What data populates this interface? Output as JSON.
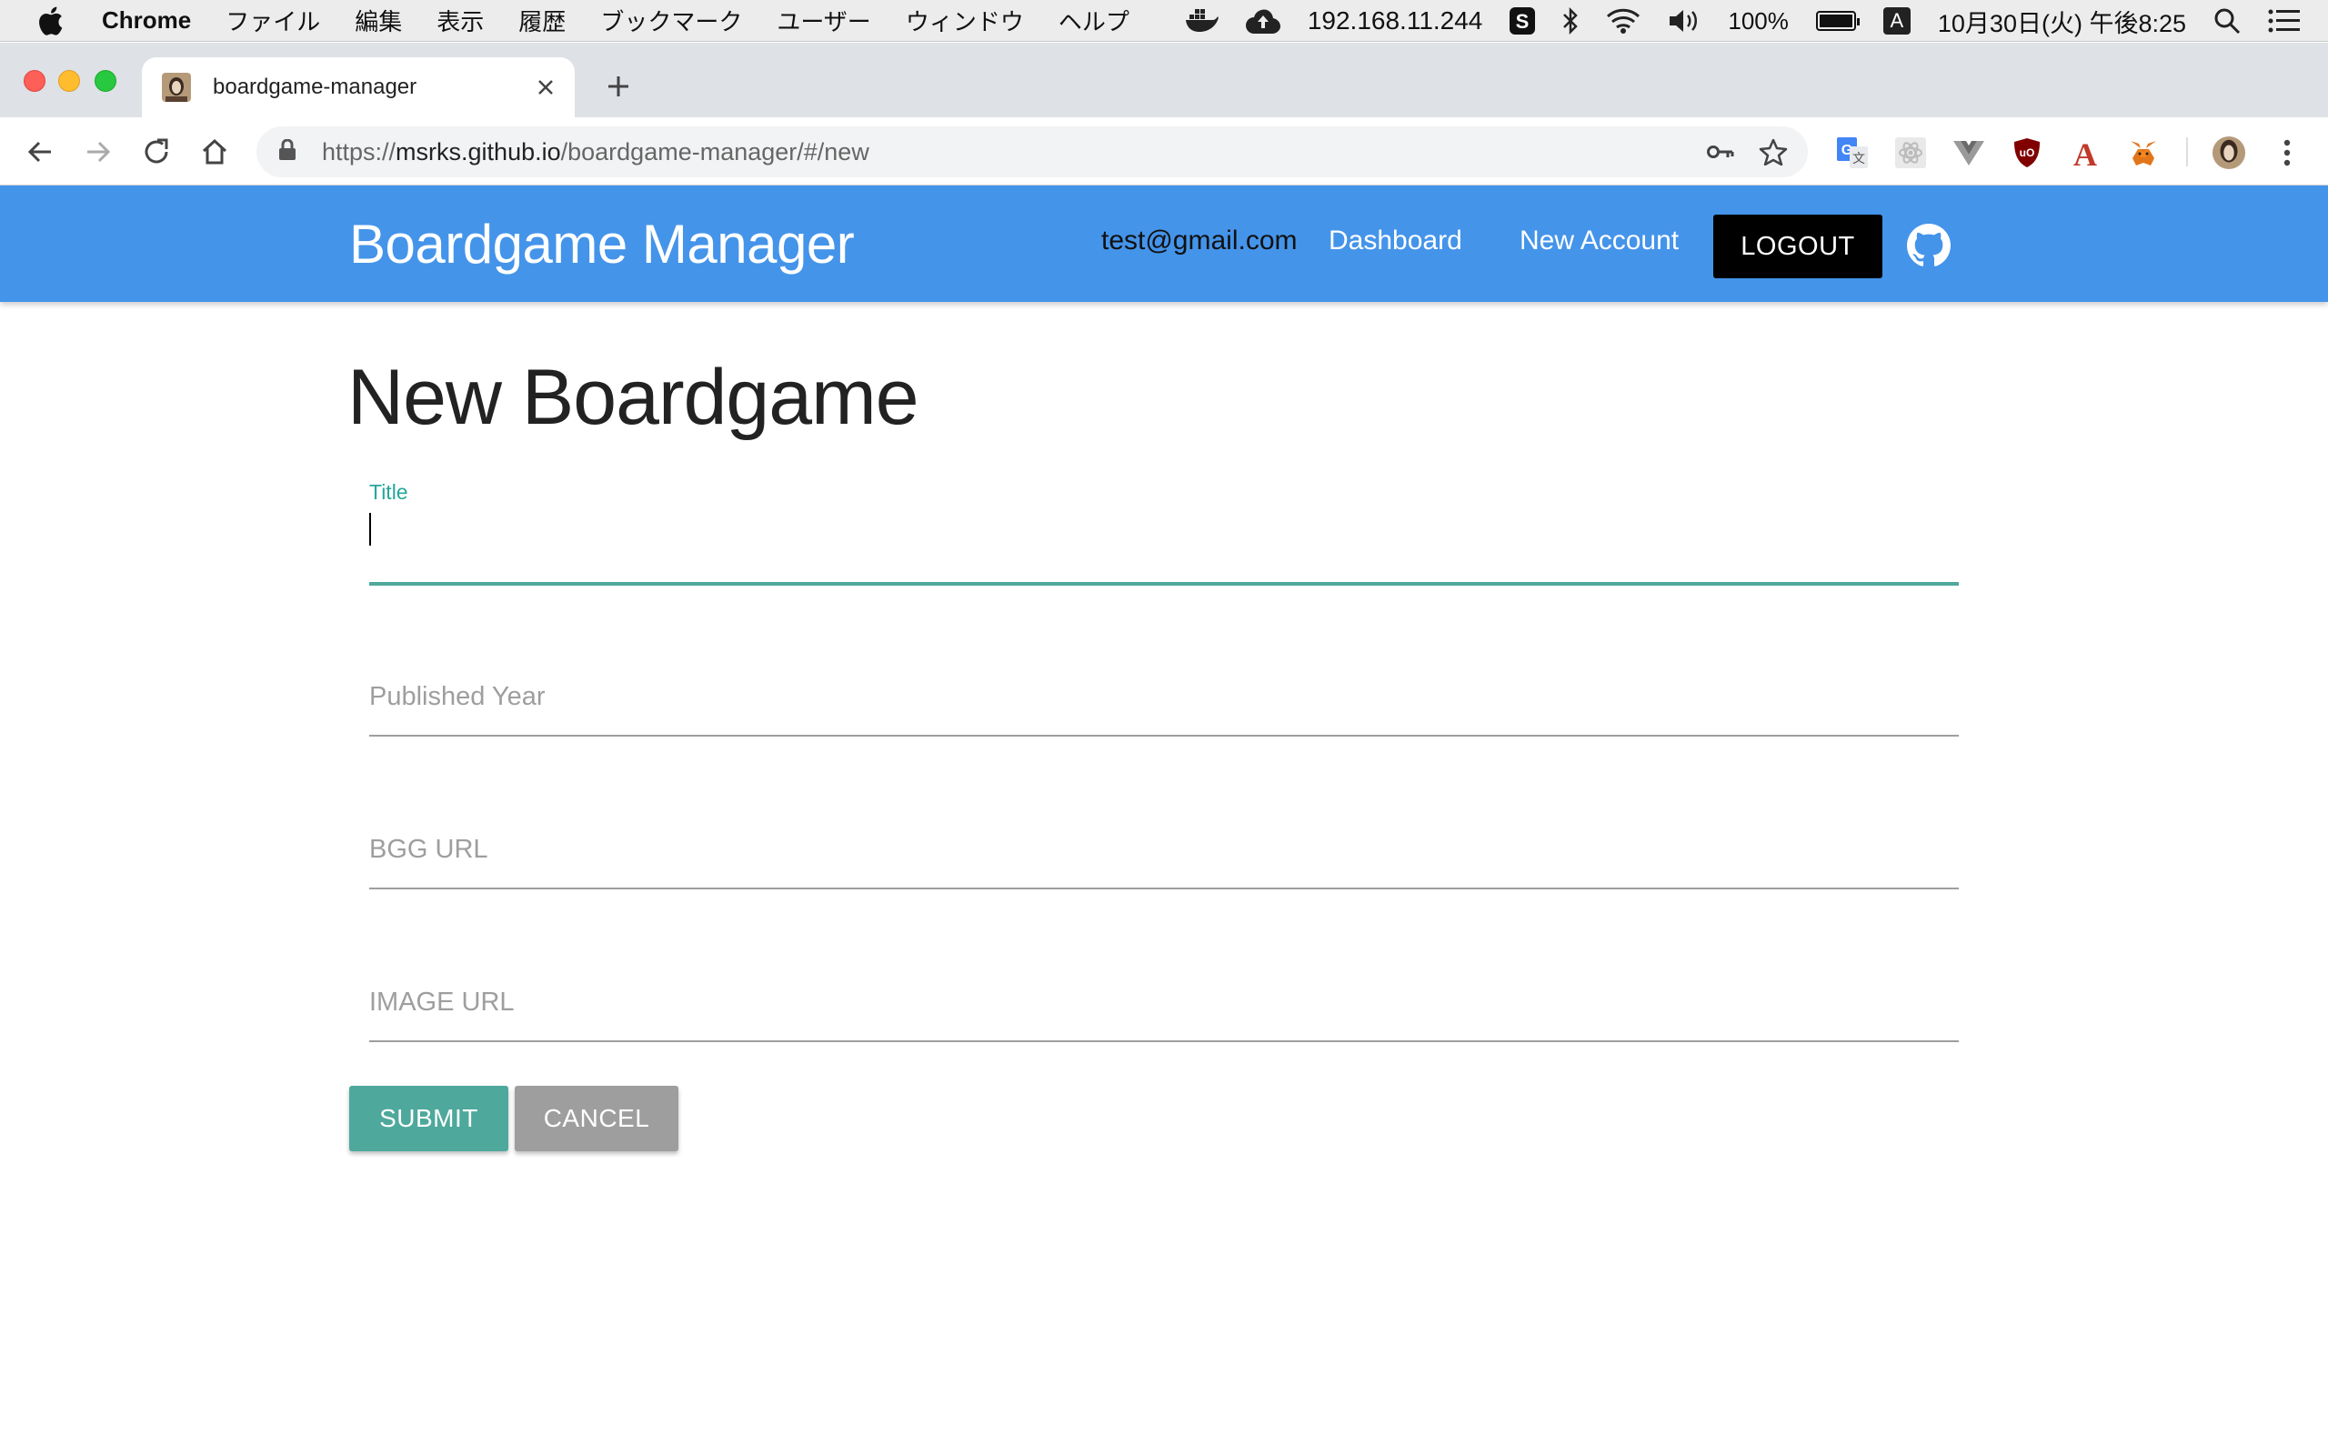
{
  "menubar": {
    "app": "Chrome",
    "items": [
      "ファイル",
      "編集",
      "表示",
      "履歴",
      "ブックマーク",
      "ユーザー",
      "ウィンドウ",
      "ヘルプ"
    ],
    "ip": "192.168.11.244",
    "battery": "100%",
    "input_mode": "A",
    "clock": "10月30日(火) 午後8:25"
  },
  "tab": {
    "title": "boardgame-manager"
  },
  "omnibox": {
    "scheme": "https://",
    "host": "msrks.github.io",
    "path": "/boardgame-manager/#/new"
  },
  "header": {
    "brand": "Boardgame Manager",
    "email": "test@gmail.com",
    "dashboard": "Dashboard",
    "new_account": "New Account",
    "logout": "LOGOUT"
  },
  "form": {
    "heading": "New Boardgame",
    "title_label": "Title",
    "title_value": "",
    "published_year_placeholder": "Published Year",
    "bgg_url_placeholder": "BGG URL",
    "image_url_placeholder": "IMAGE URL",
    "submit": "SUBMIT",
    "cancel": "CANCEL"
  },
  "colors": {
    "header": "#4494ea",
    "accent": "#26a69a",
    "submit": "#4ea89c",
    "cancel": "#9e9e9e"
  }
}
